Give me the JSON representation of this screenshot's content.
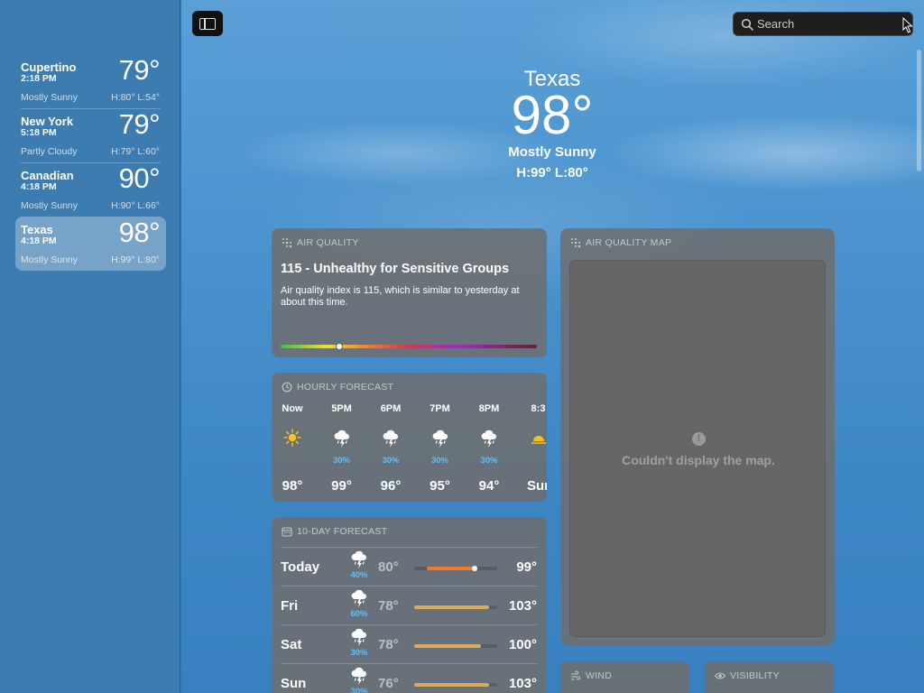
{
  "sidebar": {
    "locations": [
      {
        "name": "Cupertino",
        "time": "2:18 PM",
        "temp": "79°",
        "condition": "Mostly Sunny",
        "hilo": "H:80°  L:54°"
      },
      {
        "name": "New York",
        "time": "5:18 PM",
        "temp": "79°",
        "condition": "Partly Cloudy",
        "hilo": "H:79°  L:60°"
      },
      {
        "name": "Canadian",
        "time": "4:18 PM",
        "temp": "90°",
        "condition": "Mostly Sunny",
        "hilo": "H:90°  L:66°"
      },
      {
        "name": "Texas",
        "time": "4:18 PM",
        "temp": "98°",
        "condition": "Mostly Sunny",
        "hilo": "H:99°  L:80°"
      }
    ]
  },
  "toolbar": {
    "search_placeholder": "Search",
    "sidebar_toggle_icon": "sidebar-icon"
  },
  "current": {
    "city": "Texas",
    "temp": "98°",
    "condition": "Mostly Sunny",
    "hilo": "H:99°  L:80°"
  },
  "air_quality": {
    "title": "AIR QUALITY",
    "headline": "115 - Unhealthy for Sensitive Groups",
    "description": "Air quality index is 115, which is similar to yesterday at about this time.",
    "scale_position": 0.23
  },
  "hourly": {
    "title": "HOURLY FORECAST",
    "items": [
      {
        "time": "Now",
        "icon": "sun-icon",
        "pct": "",
        "temp": "98°"
      },
      {
        "time": "5PM",
        "icon": "thunderstorm-icon",
        "pct": "30%",
        "temp": "99°"
      },
      {
        "time": "6PM",
        "icon": "thunderstorm-icon",
        "pct": "30%",
        "temp": "96°"
      },
      {
        "time": "7PM",
        "icon": "thunderstorm-icon",
        "pct": "30%",
        "temp": "95°"
      },
      {
        "time": "8PM",
        "icon": "thunderstorm-icon",
        "pct": "30%",
        "temp": "94°"
      },
      {
        "time": "8:3",
        "icon": "sunset-icon",
        "pct": "",
        "temp": "Sur"
      }
    ]
  },
  "tenday": {
    "title": "10-DAY FORECAST",
    "days": [
      {
        "day": "Today",
        "icon": "thunderstorm-icon",
        "pct": "40%",
        "lo": "80°",
        "hi": "99°",
        "range_start": 0.15,
        "range_end": 0.72,
        "color": "#f07a28",
        "current": 0.73
      },
      {
        "day": "Fri",
        "icon": "thunderstorm-icon",
        "pct": "60%",
        "lo": "78°",
        "hi": "103°",
        "range_start": 0.0,
        "range_end": 0.9,
        "color": "#d9ad5c"
      },
      {
        "day": "Sat",
        "icon": "thunderstorm-icon",
        "pct": "30%",
        "lo": "78°",
        "hi": "100°",
        "range_start": 0.0,
        "range_end": 0.8,
        "color": "#d9ad5c"
      },
      {
        "day": "Sun",
        "icon": "thunderstorm-icon",
        "pct": "30%",
        "lo": "76°",
        "hi": "103°",
        "range_start": 0.0,
        "range_end": 0.9,
        "color": "#d9ad5c"
      }
    ]
  },
  "map": {
    "title": "AIR QUALITY MAP",
    "message": "Couldn't display the map."
  },
  "wind": {
    "title": "WIND"
  },
  "visibility": {
    "title": "VISIBILITY"
  }
}
